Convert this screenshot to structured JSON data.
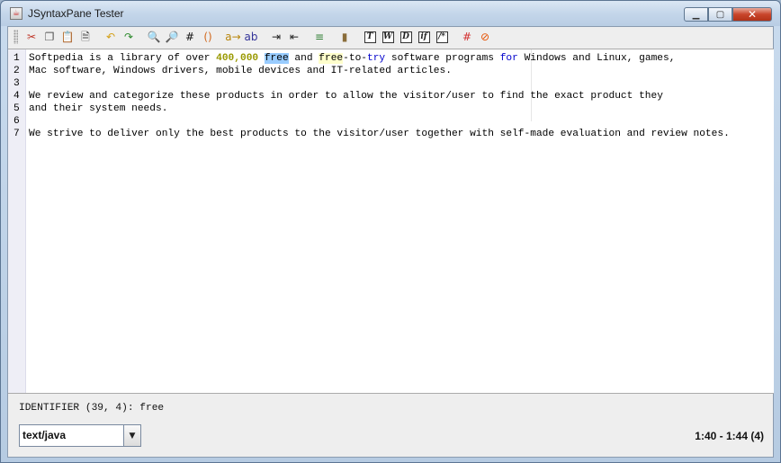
{
  "window": {
    "title": "JSyntaxPane Tester"
  },
  "toolbar": {
    "buttons": [
      {
        "name": "cut",
        "icon": "cut-icon",
        "glyph": "✂",
        "color": "#c0392b"
      },
      {
        "name": "copy",
        "icon": "copy-icon",
        "glyph": "❐",
        "color": "#555555"
      },
      {
        "name": "paste",
        "icon": "paste-icon",
        "glyph": "📋",
        "color": "#8a6d3b"
      },
      {
        "name": "select-all",
        "icon": "document-icon",
        "glyph": "🗎",
        "color": "#444444"
      },
      {
        "name": "undo",
        "icon": "undo-icon",
        "glyph": "↶",
        "color": "#d4a017"
      },
      {
        "name": "redo",
        "icon": "redo-icon",
        "glyph": "↷",
        "color": "#2e8b2e"
      },
      {
        "name": "find",
        "icon": "find-icon",
        "glyph": "🔍",
        "color": "#555555"
      },
      {
        "name": "replace",
        "icon": "replace-icon",
        "glyph": "🔎",
        "color": "#a0522d"
      },
      {
        "name": "goto-line",
        "icon": "hash-icon",
        "glyph": "#",
        "color": "#111111"
      },
      {
        "name": "match-paren",
        "icon": "parens-icon",
        "glyph": "()",
        "color": "#d2691e"
      },
      {
        "name": "complete-word",
        "icon": "complete-word-icon",
        "glyph": "a→",
        "color": "#b8860b"
      },
      {
        "name": "spell",
        "icon": "ab-icon",
        "glyph": "ab",
        "color": "#333399"
      },
      {
        "name": "indent",
        "icon": "indent-icon",
        "glyph": "⇥",
        "color": "#222222"
      },
      {
        "name": "unindent",
        "icon": "unindent-icon",
        "glyph": "⇤",
        "color": "#222222"
      },
      {
        "name": "comment",
        "icon": "comment-icon",
        "glyph": "≡",
        "color": "#2e7d32"
      },
      {
        "name": "toggle-block",
        "icon": "block-icon",
        "glyph": "▮",
        "color": "#8a6d3b"
      },
      {
        "name": "template-t",
        "icon": "template-t-icon",
        "glyph": "T",
        "color": "#222222"
      },
      {
        "name": "template-w",
        "icon": "template-w-icon",
        "glyph": "W",
        "color": "#222222"
      },
      {
        "name": "template-d",
        "icon": "template-d-icon",
        "glyph": "D",
        "color": "#222222"
      },
      {
        "name": "template-if",
        "icon": "template-if-icon",
        "glyph": "if",
        "color": "#222222"
      },
      {
        "name": "template-fn",
        "icon": "template-fn-icon",
        "glyph": "/*",
        "color": "#222222"
      },
      {
        "name": "toggle-lines",
        "icon": "line-numbers-icon",
        "glyph": "#",
        "color": "#d32f2f"
      },
      {
        "name": "clear",
        "icon": "no-icon",
        "glyph": "⊘",
        "color": "#e65100"
      }
    ]
  },
  "editor": {
    "lines": [
      {
        "n": "1",
        "segments": [
          {
            "t": "Softpedia is a library of over ",
            "c": ""
          },
          {
            "t": "400,000",
            "c": "num"
          },
          {
            "t": " ",
            "c": ""
          },
          {
            "t": "free",
            "c": "kw-free"
          },
          {
            "t": " and ",
            "c": ""
          },
          {
            "t": "free",
            "c": "kw-free2"
          },
          {
            "t": "-to-",
            "c": ""
          },
          {
            "t": "try",
            "c": "kw"
          },
          {
            "t": " software programs ",
            "c": ""
          },
          {
            "t": "for",
            "c": "kw"
          },
          {
            "t": " Windows and Linux, games,",
            "c": ""
          }
        ]
      },
      {
        "n": "2",
        "segments": [
          {
            "t": "Mac software, Windows drivers, mobile devices and IT-related articles.",
            "c": ""
          }
        ]
      },
      {
        "n": "3",
        "segments": [
          {
            "t": "",
            "c": ""
          }
        ]
      },
      {
        "n": "4",
        "segments": [
          {
            "t": "We review and categorize these products in order to allow the visitor/user to find the exact product they",
            "c": ""
          }
        ]
      },
      {
        "n": "5",
        "segments": [
          {
            "t": "and their system needs.",
            "c": ""
          }
        ]
      },
      {
        "n": "6",
        "segments": [
          {
            "t": "",
            "c": ""
          }
        ]
      },
      {
        "n": "7",
        "segments": [
          {
            "t": "We strive to deliver only the best products to the visitor/user together with self-made evaluation and review notes.",
            "c": ""
          }
        ]
      }
    ]
  },
  "status": {
    "token": "IDENTIFIER (39, 4): free",
    "content_type": "text/java",
    "caret_position": "1:40 - 1:44 (4)"
  },
  "colors": {
    "number": "#999900",
    "keyword": "#0000cc",
    "selection": "#99ccff",
    "match_highlight": "#ffffcc"
  }
}
